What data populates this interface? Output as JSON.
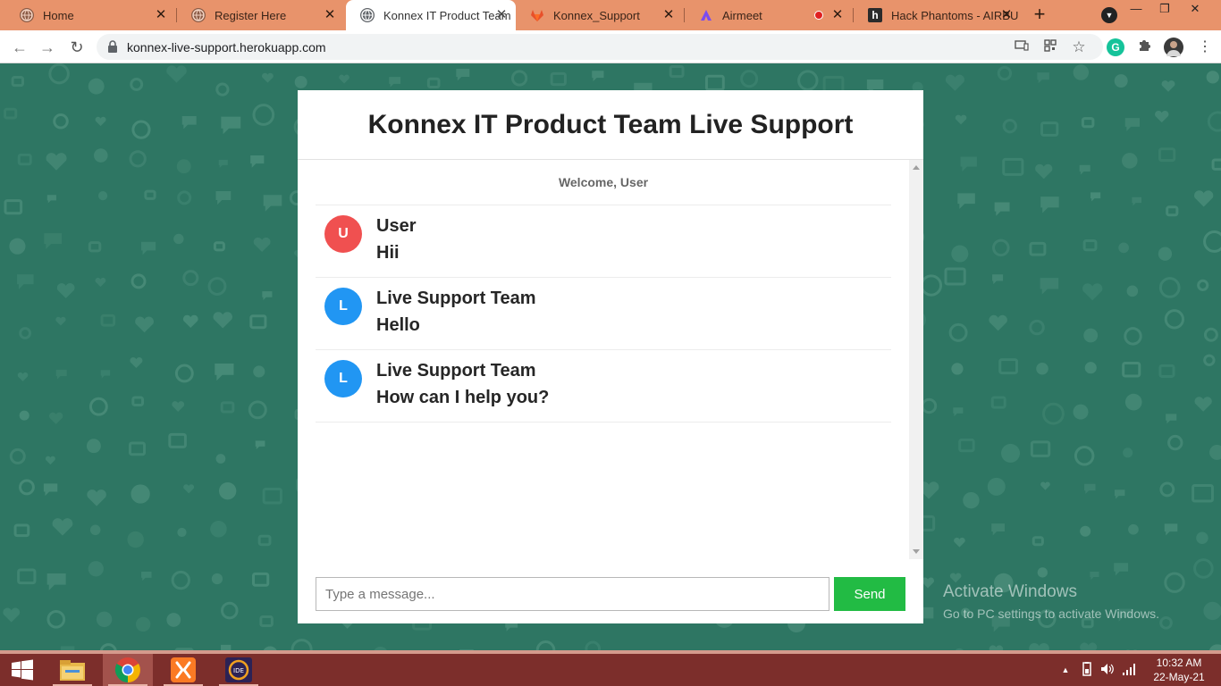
{
  "browser": {
    "tabs": [
      {
        "title": "Home",
        "icon": "globe-icon"
      },
      {
        "title": "Register Here",
        "icon": "globe-icon"
      },
      {
        "title": "Konnex IT Product Team",
        "icon": "globe-icon",
        "active": true
      },
      {
        "title": "Konnex_Support",
        "icon": "gitlab-icon"
      },
      {
        "title": "Airmeet",
        "icon": "airmeet-icon",
        "recording": true
      },
      {
        "title": "Hack Phantoms - AIRBU",
        "icon": "hashnode-icon"
      }
    ],
    "url": "konnex-live-support.herokuapp.com"
  },
  "chat": {
    "title": "Konnex IT Product Team Live Support",
    "welcome": "Welcome, User",
    "messages": [
      {
        "avatar": "U",
        "sender": "User",
        "text": "Hii",
        "color": "#f05050"
      },
      {
        "avatar": "L",
        "sender": "Live Support Team",
        "text": "Hello",
        "color": "#2196f3"
      },
      {
        "avatar": "L",
        "sender": "Live Support Team",
        "text": "How can I help you?",
        "color": "#2196f3"
      }
    ],
    "input_placeholder": "Type a message...",
    "send_label": "Send",
    "send_color": "#22bb44"
  },
  "watermark": {
    "line1": "Activate Windows",
    "line2": "Go to PC settings to activate Windows."
  },
  "taskbar": {
    "time": "10:32 AM",
    "date": "22-May-21",
    "apps": [
      "windows-start",
      "file-explorer",
      "chrome",
      "xampp",
      "java-ee-ide"
    ]
  },
  "colors": {
    "tabstrip": "#e8936b",
    "page_bg": "#2e7663",
    "taskbar": "#7c2e2b"
  }
}
